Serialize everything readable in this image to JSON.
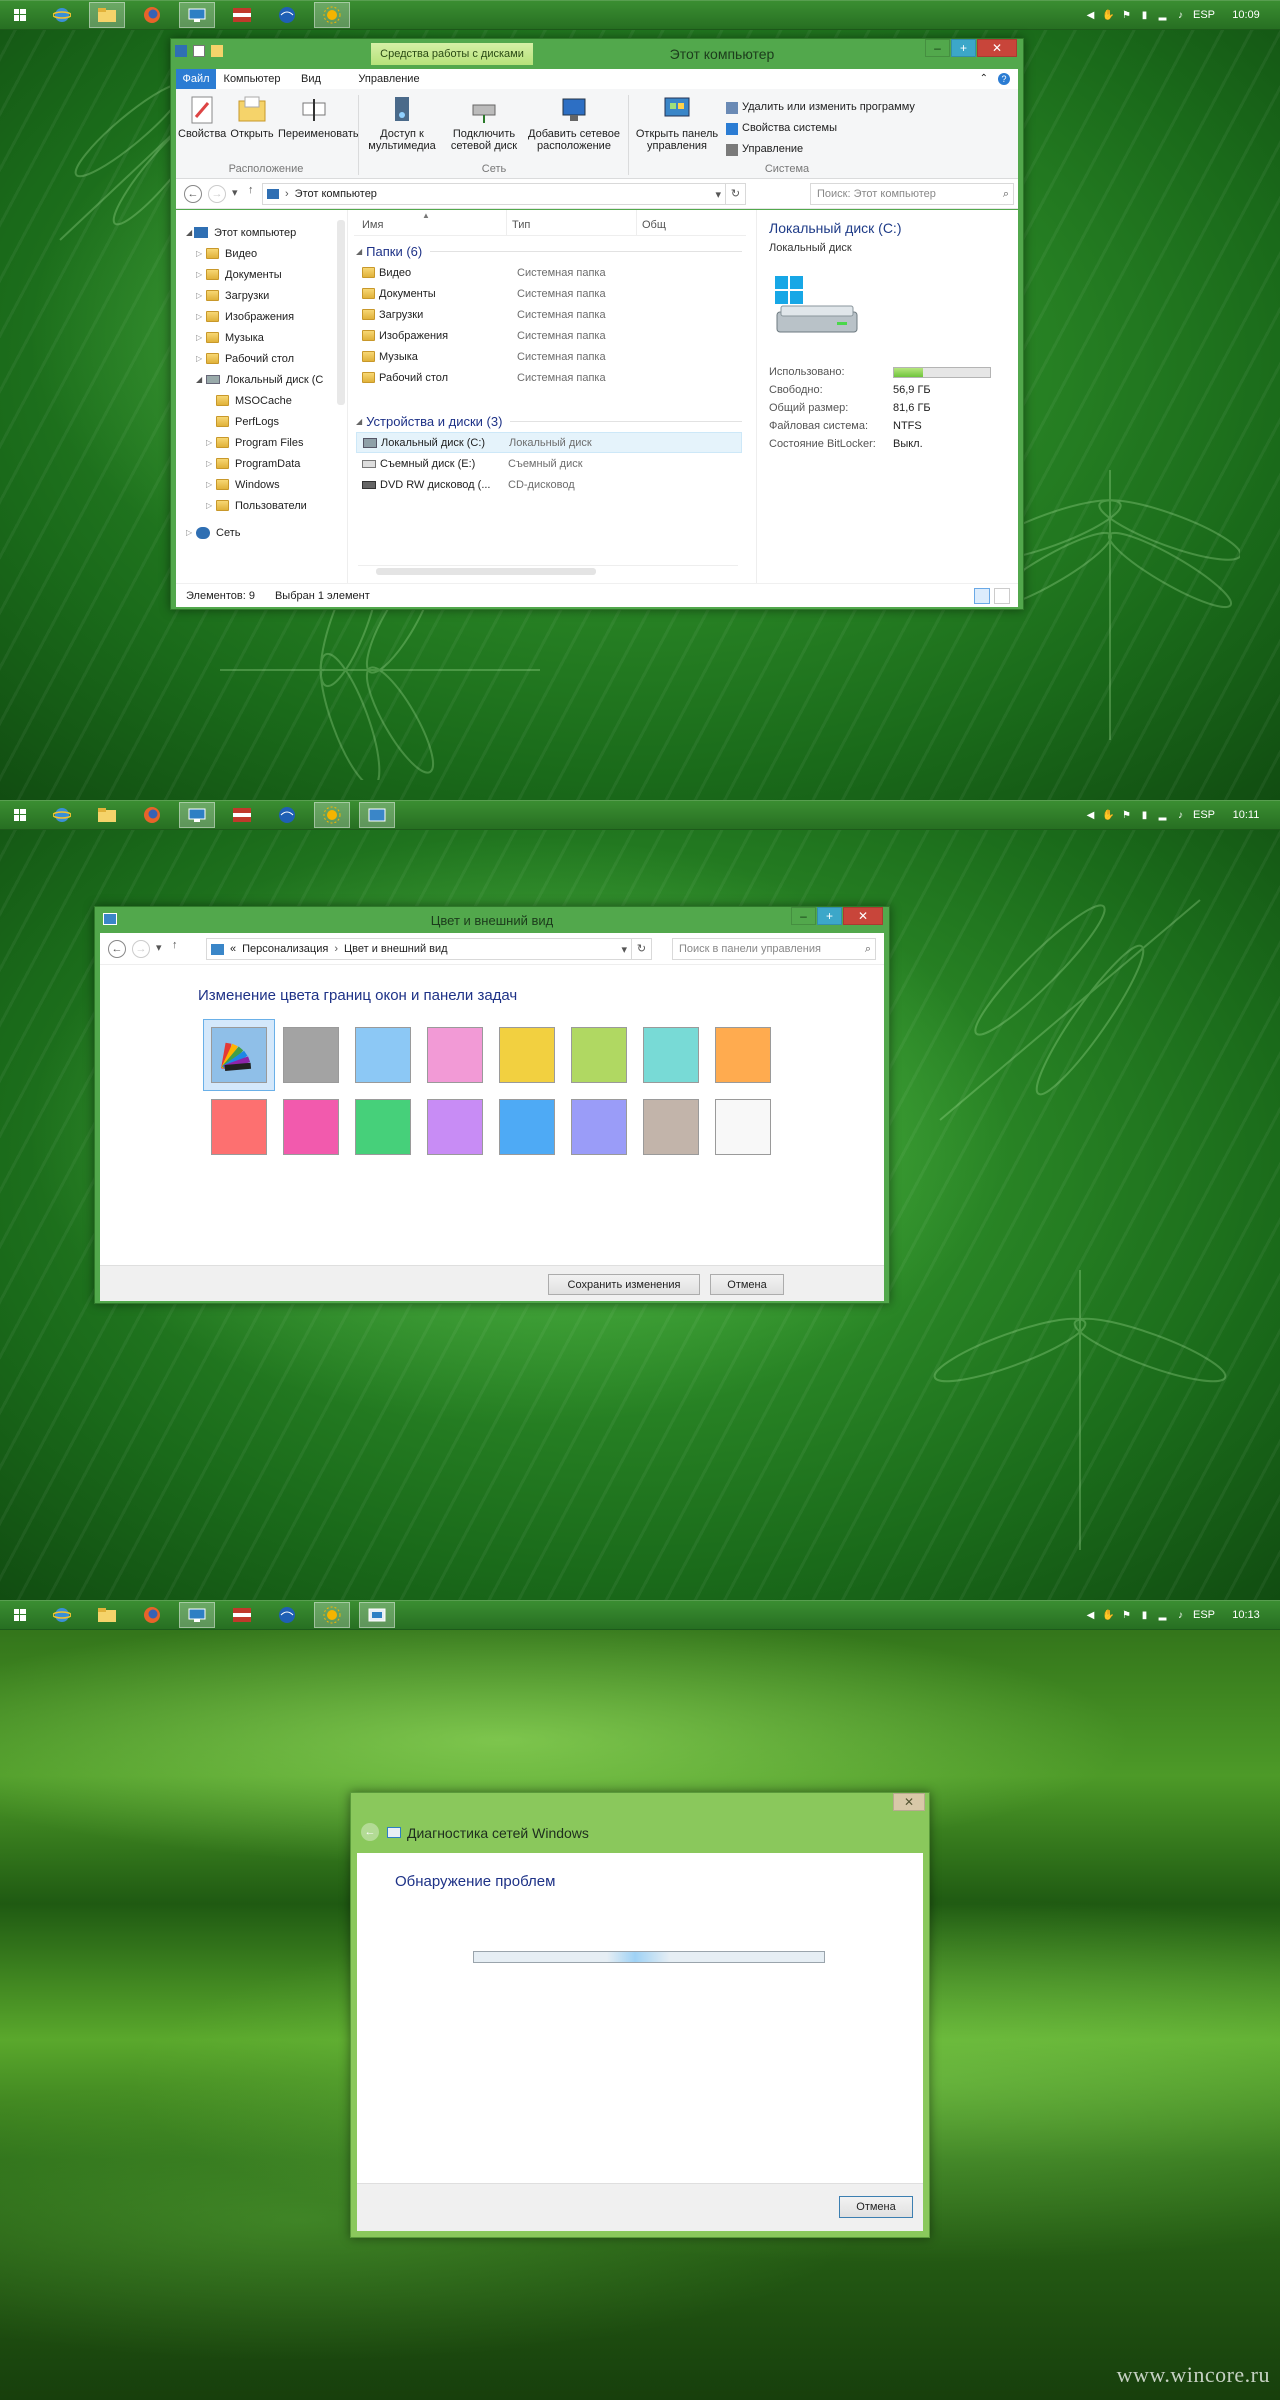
{
  "screen1": {
    "tray": {
      "lang": "ESP",
      "clock": "10:09"
    },
    "explorer": {
      "title": "Этот компьютер",
      "disk_tools_tab": "Средства работы с дисками",
      "tabs": [
        "Файл",
        "Компьютер",
        "Вид",
        "Управление"
      ],
      "ribbon": {
        "props": "Свойства",
        "open": "Открыть",
        "rename": "Переименовать",
        "group1": "Расположение",
        "media_access_1": "Доступ к",
        "media_access_2": "мультимедиа",
        "map_drive_1": "Подключить",
        "map_drive_2": "сетевой диск",
        "add_net_1": "Добавить сетевое",
        "add_net_2": "расположение",
        "group2": "Сеть",
        "open_cp_1": "Открыть панель",
        "open_cp_2": "управления",
        "uninstall": "Удалить или изменить программу",
        "sys_props": "Свойства системы",
        "manage": "Управление",
        "group3": "Система"
      },
      "address": "Этот компьютер",
      "search_placeholder": "Поиск: Этот компьютер",
      "nav": [
        "Этот компьютер",
        "Видео",
        "Документы",
        "Загрузки",
        "Изображения",
        "Музыка",
        "Рабочий стол",
        "Локальный диск (C",
        "MSOCache",
        "PerfLogs",
        "Program Files",
        "ProgramData",
        "Windows",
        "Пользователи",
        "Сеть"
      ],
      "columns": {
        "name": "Имя",
        "type": "Тип",
        "total": "Общ"
      },
      "folders_group": "Папки (6)",
      "folders": [
        {
          "name": "Видео",
          "type": "Системная папка"
        },
        {
          "name": "Документы",
          "type": "Системная папка"
        },
        {
          "name": "Загрузки",
          "type": "Системная папка"
        },
        {
          "name": "Изображения",
          "type": "Системная папка"
        },
        {
          "name": "Музыка",
          "type": "Системная папка"
        },
        {
          "name": "Рабочий стол",
          "type": "Системная папка"
        }
      ],
      "devices_group": "Устройства и диски (3)",
      "devices": [
        {
          "name": "Локальный диск (C:)",
          "type": "Локальный диск"
        },
        {
          "name": "Съемный диск (E:)",
          "type": "Съемный диск"
        },
        {
          "name": "DVD RW дисковод (...",
          "type": "CD-дисковод"
        }
      ],
      "details": {
        "title": "Локальный диск (C:)",
        "subtitle": "Локальный диск",
        "used_label": "Использовано:",
        "used_fraction": 0.3,
        "free_label": "Свободно:",
        "free_value": "56,9 ГБ",
        "total_label": "Общий размер:",
        "total_value": "81,6 ГБ",
        "fs_label": "Файловая система:",
        "fs_value": "NTFS",
        "bitlocker_label": "Состояние BitLocker:",
        "bitlocker_value": "Выкл."
      },
      "status": {
        "items": "Элементов: 9",
        "selected": "Выбран 1 элемент"
      }
    }
  },
  "screen2": {
    "tray": {
      "lang": "ESP",
      "clock": "10:11"
    },
    "window": {
      "title": "Цвет и внешний вид",
      "breadcrumb_prefix": "«",
      "crumb1": "Персонализация",
      "crumb2": "Цвет и внешний вид",
      "search_placeholder": "Поиск в панели управления",
      "heading": "Изменение цвета границ окон и панели задач",
      "swatches_row1": [
        "#a3a3a3",
        "#8cc8f5",
        "#f29ad6",
        "#f2d040",
        "#b0d862",
        "#78dad6",
        "#ffab4f"
      ],
      "swatches_row2": [
        "#fd7070",
        "#f25aad",
        "#46d07a",
        "#c88cf5",
        "#4eaaf5",
        "#9a9cf8",
        "#c2b4aa",
        "#f8f8f8"
      ],
      "save": "Сохранить изменения",
      "cancel": "Отмена"
    }
  },
  "screen3": {
    "tray": {
      "lang": "ESP",
      "clock": "10:13"
    },
    "window": {
      "title": "Диагностика сетей Windows",
      "heading": "Обнаружение проблем",
      "cancel": "Отмена"
    },
    "watermark": "www.wincore.ru"
  }
}
